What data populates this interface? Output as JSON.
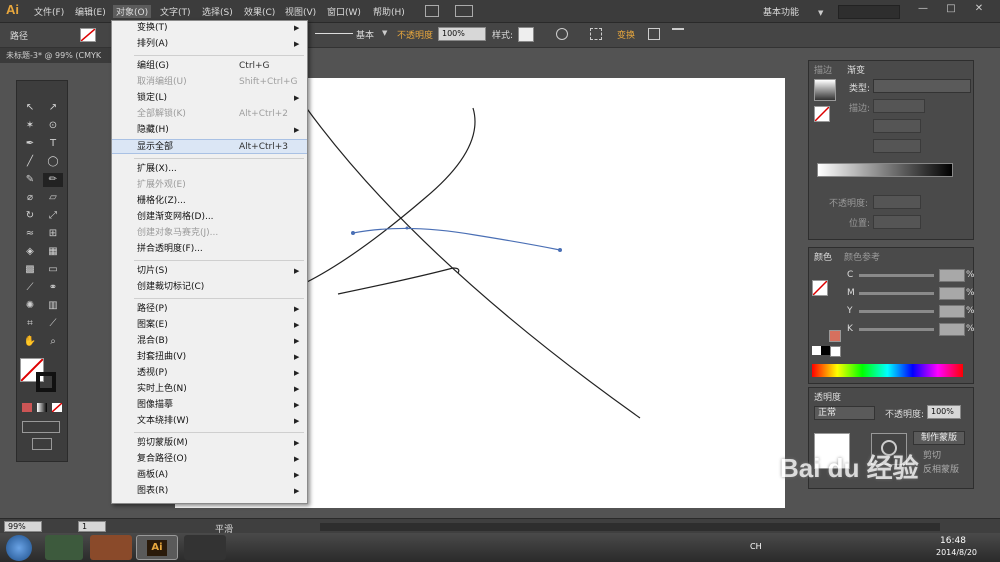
{
  "app": {
    "logo": "Ai",
    "menus": [
      "文件(F)",
      "编辑(E)",
      "对象(O)",
      "文字(T)",
      "选择(S)",
      "效果(C)",
      "视图(V)",
      "窗口(W)",
      "帮助(H)"
    ],
    "workspace": "基本功能",
    "window_controls": [
      "—",
      "□",
      "✕"
    ]
  },
  "control_bar": {
    "selection_label": "路径",
    "stroke_style": "基本",
    "opacity_label": "不透明度",
    "opacity_value": "100%",
    "style_label": "样式:",
    "transform_label": "变换"
  },
  "document_tab": "未标题-3* @ 99% (CMYK",
  "object_menu": {
    "items": [
      {
        "label": "变换(T)",
        "shortcut": "",
        "submenu": true,
        "disabled": false
      },
      {
        "label": "排列(A)",
        "shortcut": "",
        "submenu": true,
        "disabled": false
      },
      {
        "label": "编组(G)",
        "shortcut": "Ctrl+G",
        "submenu": false,
        "disabled": false
      },
      {
        "label": "取消编组(U)",
        "shortcut": "Shift+Ctrl+G",
        "submenu": false,
        "disabled": true
      },
      {
        "label": "锁定(L)",
        "shortcut": "",
        "submenu": true,
        "disabled": false
      },
      {
        "label": "全部解锁(K)",
        "shortcut": "Alt+Ctrl+2",
        "submenu": false,
        "disabled": true
      },
      {
        "label": "隐藏(H)",
        "shortcut": "",
        "submenu": true,
        "disabled": false
      },
      {
        "label": "显示全部",
        "shortcut": "Alt+Ctrl+3",
        "submenu": false,
        "disabled": false,
        "highlighted": true
      },
      {
        "label": "扩展(X)...",
        "shortcut": "",
        "submenu": false,
        "disabled": false
      },
      {
        "label": "扩展外观(E)",
        "shortcut": "",
        "submenu": false,
        "disabled": true
      },
      {
        "label": "栅格化(Z)...",
        "shortcut": "",
        "submenu": false,
        "disabled": false
      },
      {
        "label": "创建渐变网格(D)...",
        "shortcut": "",
        "submenu": false,
        "disabled": false
      },
      {
        "label": "创建对象马赛克(J)...",
        "shortcut": "",
        "submenu": false,
        "disabled": true
      },
      {
        "label": "拼合透明度(F)...",
        "shortcut": "",
        "submenu": false,
        "disabled": false
      },
      {
        "label": "切片(S)",
        "shortcut": "",
        "submenu": true,
        "disabled": false
      },
      {
        "label": "创建裁切标记(C)",
        "shortcut": "",
        "submenu": false,
        "disabled": false
      },
      {
        "label": "路径(P)",
        "shortcut": "",
        "submenu": true,
        "disabled": false
      },
      {
        "label": "图案(E)",
        "shortcut": "",
        "submenu": true,
        "disabled": false
      },
      {
        "label": "混合(B)",
        "shortcut": "",
        "submenu": true,
        "disabled": false
      },
      {
        "label": "封套扭曲(V)",
        "shortcut": "",
        "submenu": true,
        "disabled": false
      },
      {
        "label": "透视(P)",
        "shortcut": "",
        "submenu": true,
        "disabled": false
      },
      {
        "label": "实时上色(N)",
        "shortcut": "",
        "submenu": true,
        "disabled": false
      },
      {
        "label": "图像描摹",
        "shortcut": "",
        "submenu": true,
        "disabled": false
      },
      {
        "label": "文本绕排(W)",
        "shortcut": "",
        "submenu": true,
        "disabled": false
      },
      {
        "label": "剪切蒙版(M)",
        "shortcut": "",
        "submenu": true,
        "disabled": false
      },
      {
        "label": "复合路径(O)",
        "shortcut": "",
        "submenu": true,
        "disabled": false
      },
      {
        "label": "画板(A)",
        "shortcut": "",
        "submenu": true,
        "disabled": false
      },
      {
        "label": "图表(R)",
        "shortcut": "",
        "submenu": true,
        "disabled": false
      }
    ],
    "submenu_arrow": "▶"
  },
  "gradient_panel": {
    "tabs": [
      "描边",
      "渐变"
    ],
    "type_label": "类型:",
    "stroke_label": "描边:",
    "opacity_label": "不透明度:",
    "position_label": "位置:"
  },
  "color_panel": {
    "tabs": [
      "颜色",
      "颜色参考"
    ],
    "channels": [
      "C",
      "M",
      "Y",
      "K"
    ],
    "unit": "%"
  },
  "transparency_panel": {
    "tab": "透明度",
    "blend_mode": "正常",
    "opacity_label": "不透明度:",
    "opacity_value": "100%",
    "make_mask_button": "制作蒙版",
    "clip_label": "剪切",
    "invert_label": "反相蒙版"
  },
  "status_bar": {
    "zoom": "99%",
    "artboard_number": "1",
    "tool_state": "平滑"
  },
  "taskbar": {
    "ime": "CH",
    "time": "16:48",
    "date": "2014/8/20",
    "ai_button": "Ai"
  },
  "watermark": "Bai du 经验",
  "colors": {
    "menu_bg": "#f0f0f0",
    "menu_highlight": "#dbe6f5",
    "ui_dark": "#535353",
    "ai_orange": "#e8a73d",
    "disabled_text": "#9a9a9a",
    "path_selected": "#4a6fb5"
  },
  "icons": [
    "selection-tool-icon",
    "direct-selection-tool-icon",
    "pen-tool-icon",
    "type-tool-icon",
    "line-tool-icon",
    "ellipse-tool-icon",
    "brush-tool-icon",
    "pencil-tool-icon",
    "eraser-tool-icon",
    "rotate-tool-icon",
    "scale-tool-icon",
    "hand-tool-icon",
    "zoom-tool-icon",
    "fill-swatch-icon",
    "stroke-swatch-icon",
    "no-entry-icon",
    "start-orb-icon",
    "qq-icon"
  ]
}
